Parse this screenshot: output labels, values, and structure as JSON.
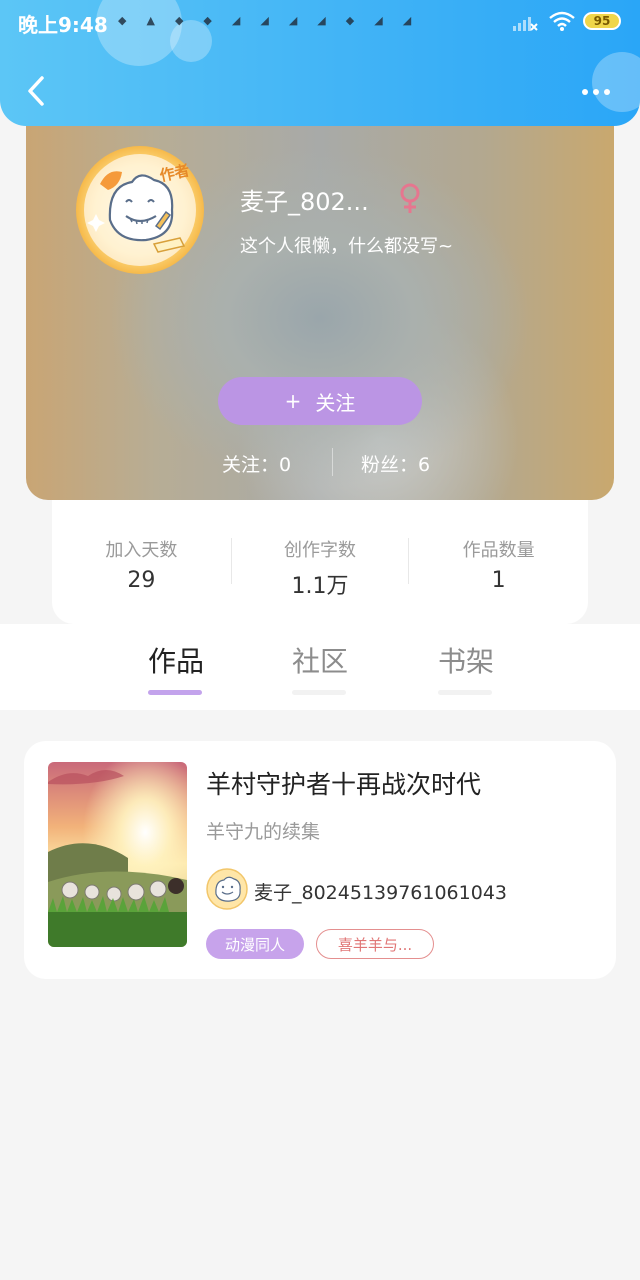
{
  "status_bar": {
    "time": "晚上9:48",
    "battery": "95",
    "notification_icons": [
      "notif-icon",
      "notif-icon",
      "notif-icon",
      "notif-icon",
      "notif-icon",
      "notif-icon",
      "notif-icon",
      "notif-icon",
      "notif-icon",
      "notif-icon",
      "notif-icon"
    ]
  },
  "header": {
    "back_icon": "chevron-left-icon",
    "more_icon": "more-dots-icon",
    "color": "#3fb2f6"
  },
  "profile": {
    "username": "麦子_802...",
    "gender": "female",
    "gender_color": "#e6768f",
    "bio": "这个人很懒，什么都没写~",
    "avatar_badge": "作者",
    "follow_button": {
      "icon": "+",
      "label": "关注",
      "color": "#bb95e4"
    },
    "following_text": "关注：0",
    "fans_text": "粉丝：6"
  },
  "stats": [
    {
      "label": "加入天数",
      "value": "29"
    },
    {
      "label": "创作字数",
      "value": "1.1万"
    },
    {
      "label": "作品数量",
      "value": "1"
    }
  ],
  "tabs": [
    {
      "label": "作品",
      "active": true
    },
    {
      "label": "社区",
      "active": false
    },
    {
      "label": "书架",
      "active": false
    }
  ],
  "works": [
    {
      "title": "羊村守护者十再战次时代",
      "description": "羊守九的续集",
      "author": "麦子_80245139761061043",
      "tags": [
        {
          "label": "动漫同人",
          "style": "filled",
          "color": "#c7a3eb"
        },
        {
          "label": "喜羊羊与...",
          "style": "outline",
          "color": "#e07676"
        }
      ]
    }
  ]
}
